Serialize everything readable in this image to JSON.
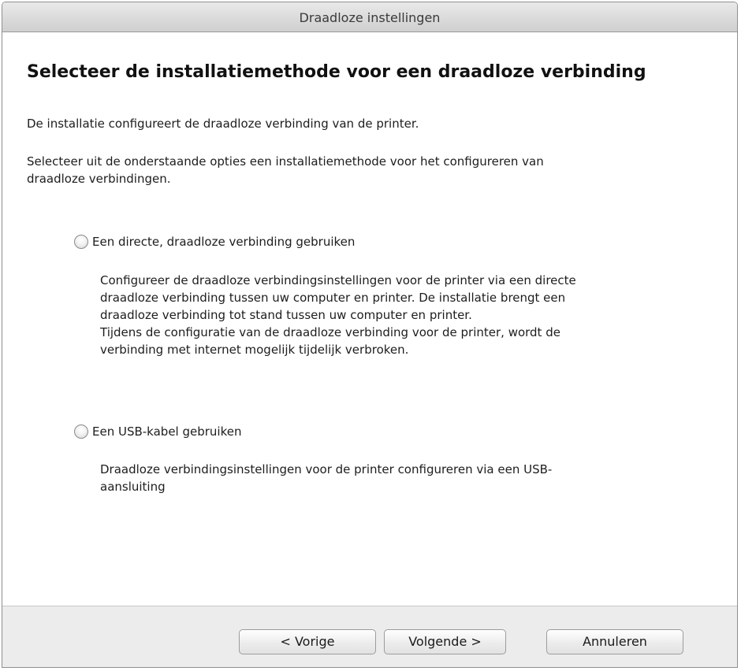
{
  "window": {
    "title": "Draadloze instellingen"
  },
  "content": {
    "heading": "Selecteer de installatiemethode voor een draadloze verbinding",
    "intro": "De installatie configureert de draadloze verbinding van de printer.",
    "instruction_line1": "Selecteer uit de onderstaande opties een installatiemethode voor het configureren van",
    "instruction_line2": "draadloze verbindingen."
  },
  "options": [
    {
      "label": "Een directe, draadloze verbinding gebruiken",
      "selected": false,
      "description_lines": [
        "Configureer de draadloze verbindingsinstellingen voor de printer via een directe",
        "draadloze verbinding tussen uw computer en printer. De installatie brengt een",
        "draadloze verbinding tot stand tussen uw computer en printer.",
        "Tijdens de configuratie van de draadloze verbinding voor de printer, wordt de",
        "verbinding met internet mogelijk tijdelijk verbroken."
      ]
    },
    {
      "label": "Een USB-kabel gebruiken",
      "selected": false,
      "description_lines": [
        "Draadloze verbindingsinstellingen voor de printer configureren via een USB-",
        "aansluiting"
      ]
    }
  ],
  "buttons": {
    "previous": "< Vorige",
    "next": "Volgende >",
    "cancel": "Annuleren"
  }
}
